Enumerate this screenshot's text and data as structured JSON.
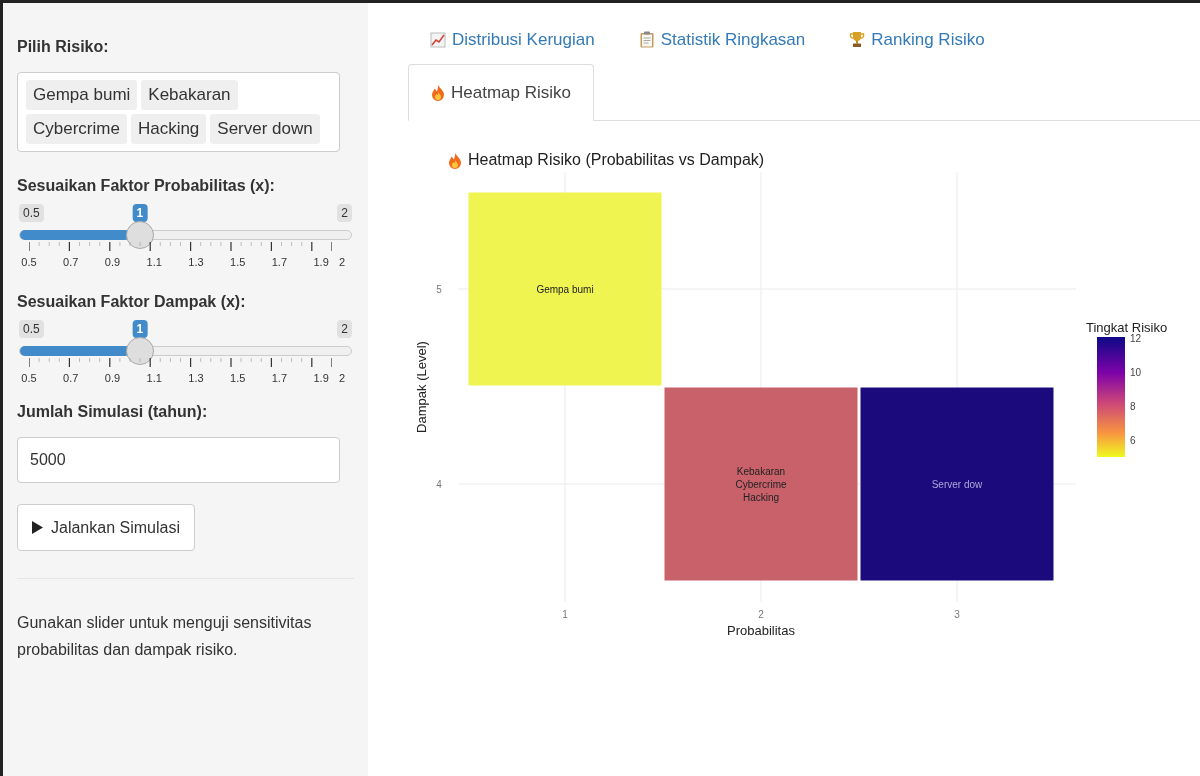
{
  "sidebar": {
    "risk_select": {
      "label": "Pilih Risiko:",
      "tags": [
        "Gempa bumi",
        "Kebakaran",
        "Cybercrime",
        "Hacking",
        "Server down"
      ]
    },
    "sliders": [
      {
        "label": "Sesuaikan Faktor Probabilitas (x):",
        "min_label": "0.5",
        "max_label": "2",
        "value": "1",
        "level": 0.333,
        "tick_labels": [
          "0.5",
          "0.7",
          "0.9",
          "1.1",
          "1.3",
          "1.5",
          "1.7",
          "1.9",
          "2"
        ]
      },
      {
        "label": "Sesuaikan Faktor Dampak (x):",
        "min_label": "0.5",
        "max_label": "2",
        "value": "1",
        "level": 0.333,
        "tick_labels": [
          "0.5",
          "0.7",
          "0.9",
          "1.1",
          "1.3",
          "1.5",
          "1.7",
          "1.9",
          "2"
        ]
      }
    ],
    "simulations": {
      "label": "Jumlah Simulasi (tahun):",
      "value": "5000"
    },
    "run_button": "Jalankan Simulasi",
    "help_text": "Gunakan slider untuk menguji sensitivitas probabilitas dan dampak risiko."
  },
  "tabs": [
    {
      "label": "Distribusi Kerugian",
      "kind": "chart",
      "selected": false
    },
    {
      "label": "Statistik Ringkasan",
      "kind": "clipboard",
      "selected": false
    },
    {
      "label": "Ranking Risiko",
      "kind": "trophy",
      "selected": false
    },
    {
      "label": "Heatmap Risiko",
      "kind": "fire",
      "selected": true
    }
  ],
  "heatmap": {
    "title": "Heatmap Risiko (Probabilitas vs Dampak)",
    "ylabel": "Dampak (Level)",
    "impact_levels": [
      {
        "tick": "5",
        "risks_by_probability": [
          {
            "kind": "tile",
            "labels": [
              "Gempa bumi"
            ],
            "color": "#f0f450"
          },
          {
            "kind": "blank"
          },
          {
            "kind": "blank"
          }
        ]
      },
      {
        "tick": "4",
        "risks_by_probability": [
          {
            "kind": "blank"
          },
          {
            "kind": "tile",
            "labels": [
              "Kebakaran",
              "Cybercrime",
              "Hacking"
            ],
            "color": "#c8616a"
          },
          {
            "kind": "tile",
            "labels": [
              "Server dow"
            ],
            "color": "#1b0a7c"
          }
        ]
      }
    ],
    "probability_ticks": [
      "1",
      "2",
      "3"
    ],
    "xlabel": "Probabilitas",
    "legend": {
      "title": "Tingkat Risiko",
      "ticks": [
        "12",
        "10",
        "8",
        "6"
      ]
    }
  }
}
